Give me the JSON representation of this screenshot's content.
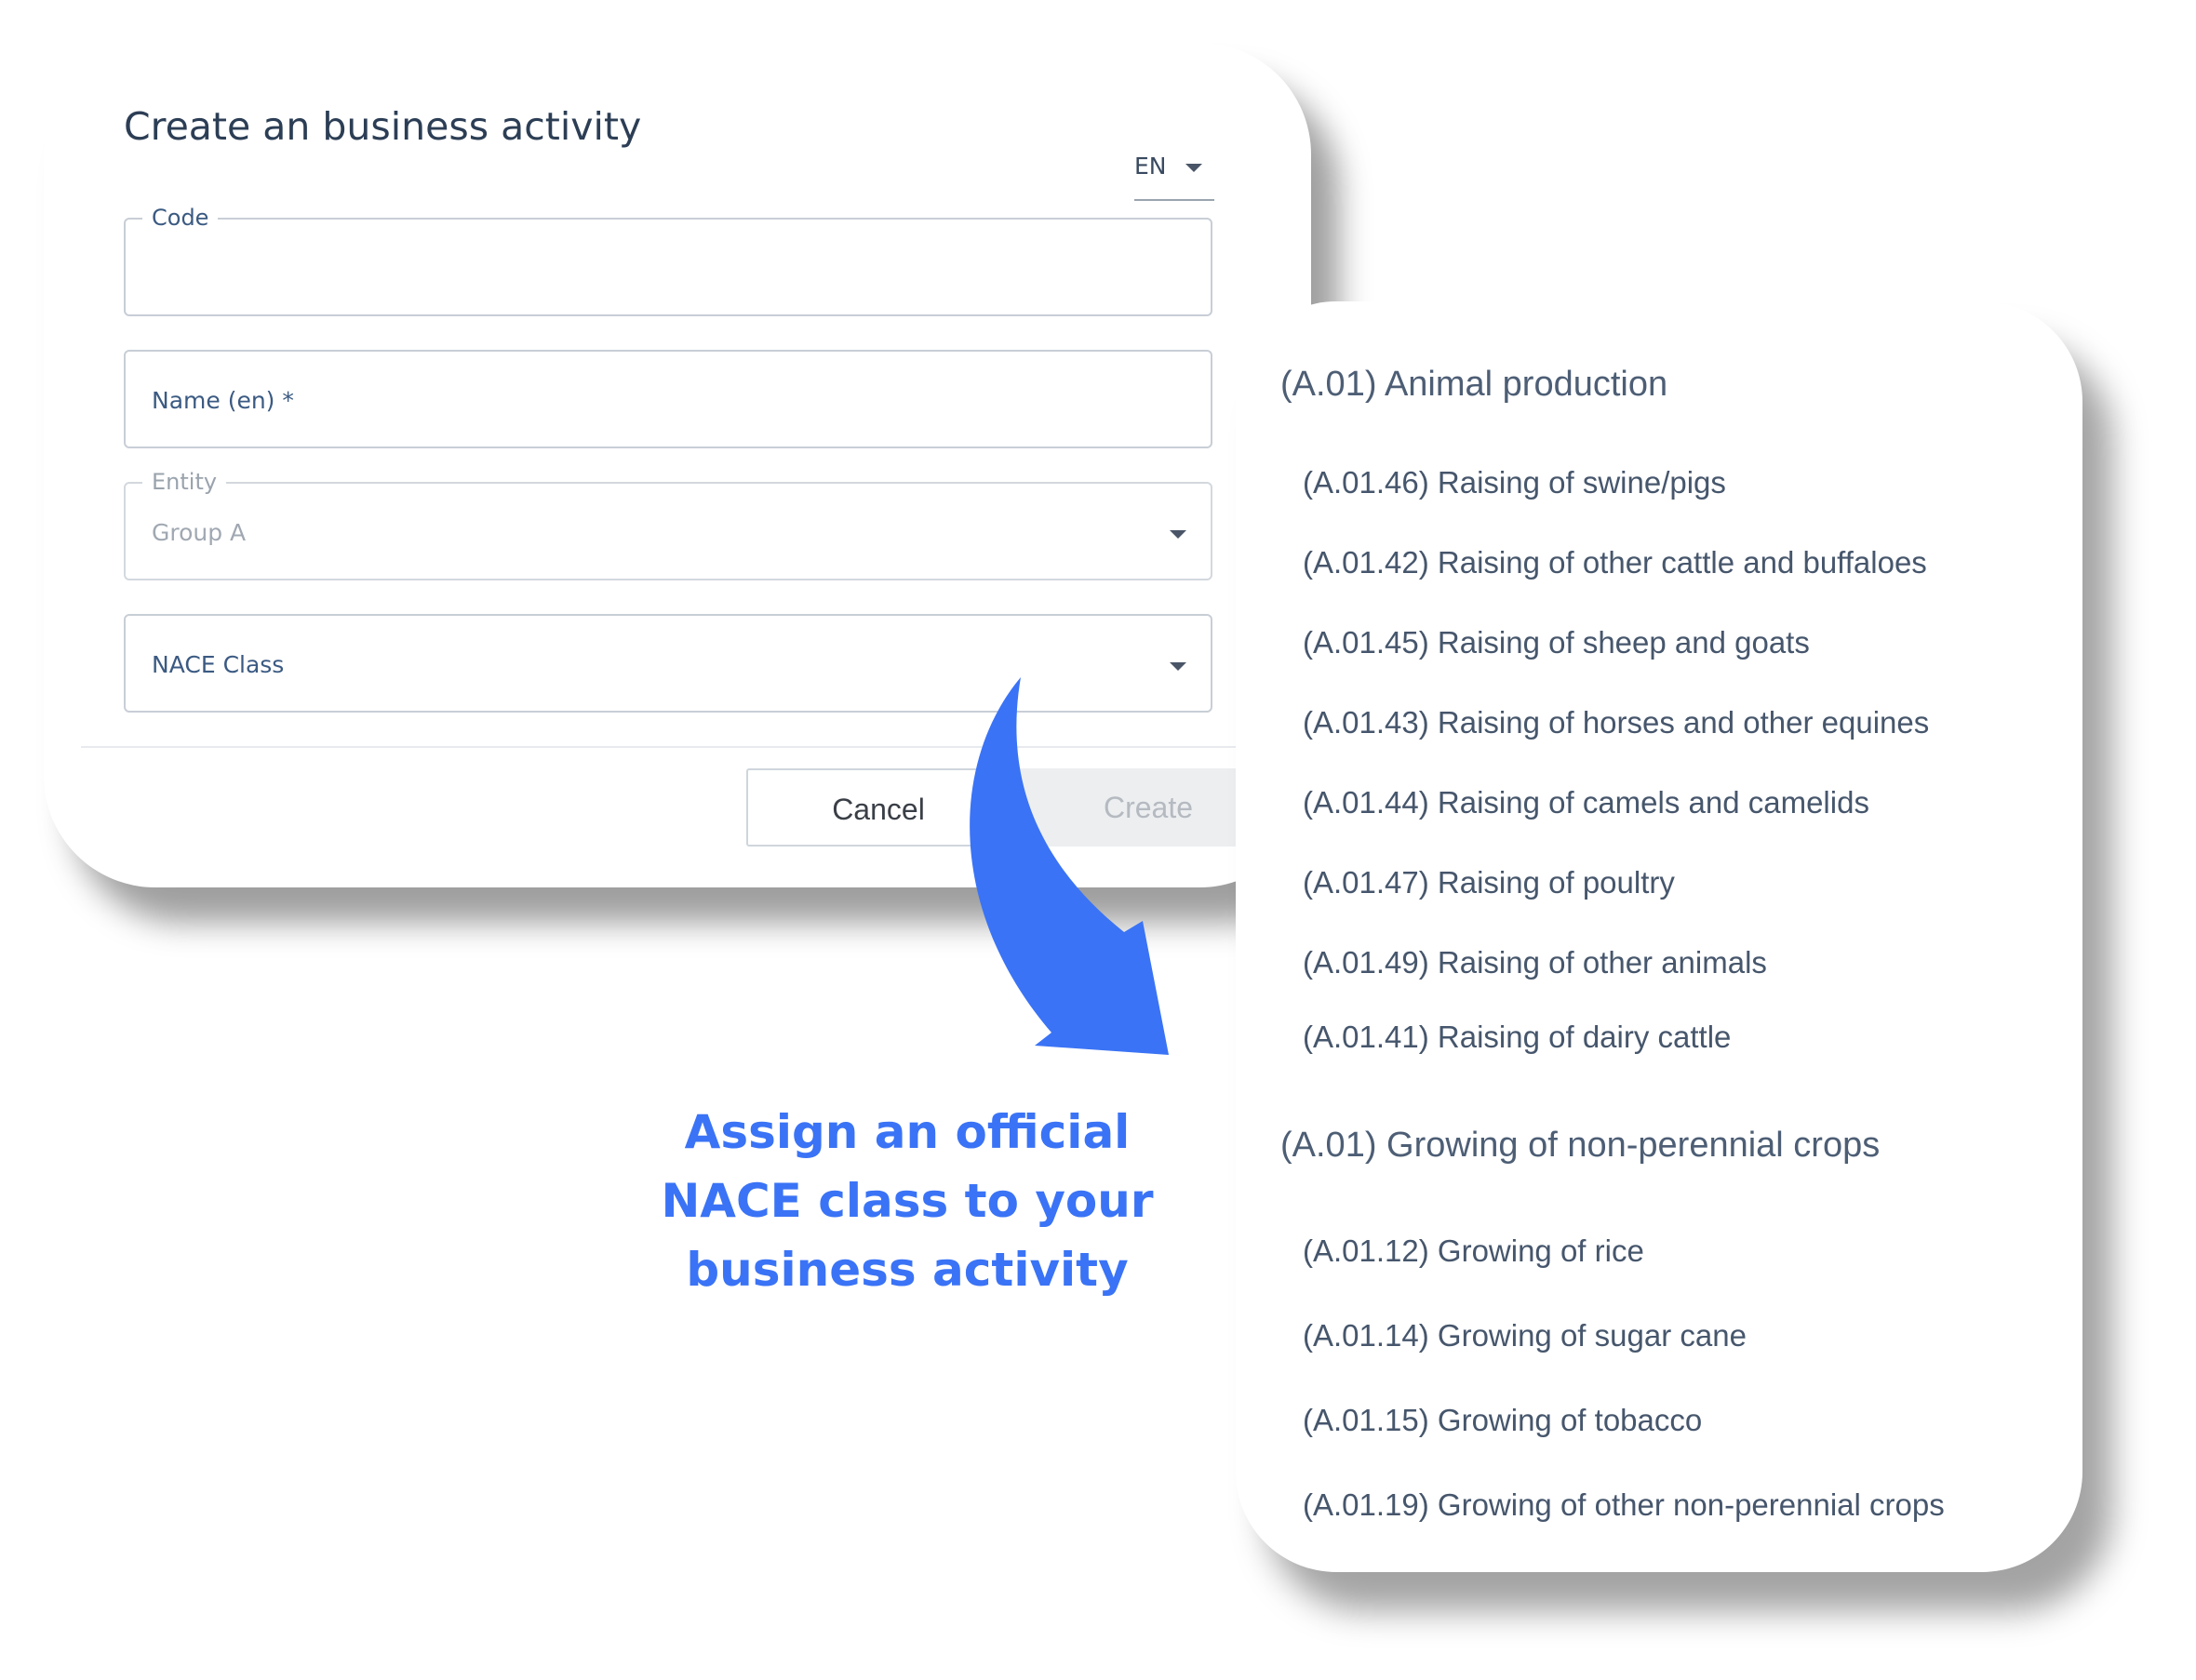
{
  "dialog": {
    "title": "Create an business activity",
    "language": "EN",
    "fields": {
      "code": {
        "label": "Code",
        "value": ""
      },
      "name": {
        "placeholder": "Name (en)  *"
      },
      "entity": {
        "label": "Entity",
        "value": "Group A"
      },
      "nace": {
        "placeholder": "NACE Class"
      }
    },
    "buttons": {
      "cancel": "Cancel",
      "create": "Create"
    }
  },
  "nace_list": {
    "groups": [
      {
        "header": "(A.01) Animal production",
        "items": [
          "(A.01.46) Raising of swine/pigs",
          "(A.01.42) Raising of other cattle and buffaloes",
          "(A.01.45) Raising of sheep and goats",
          "(A.01.43) Raising of horses and other equines",
          "(A.01.44) Raising of camels and camelids",
          "(A.01.47) Raising of poultry",
          "(A.01.49) Raising of other animals",
          "(A.01.41) Raising of dairy cattle"
        ]
      },
      {
        "header": "(A.01) Growing of non-perennial crops",
        "items": [
          "(A.01.12) Growing of rice",
          "(A.01.14) Growing of sugar cane",
          "(A.01.15) Growing of tobacco",
          "(A.01.19) Growing of other non-perennial crops"
        ]
      }
    ]
  },
  "caption": {
    "line1": "Assign an official",
    "line2": "NACE class to your",
    "line3": "business activity"
  },
  "colors": {
    "accent": "#3a73f5",
    "label": "#3b5a82",
    "title": "#2c3e55"
  },
  "icons": {
    "language_dropdown": "chevron-down-icon",
    "entity_dropdown": "chevron-down-icon",
    "nace_dropdown": "chevron-down-icon",
    "arrow": "curved-arrow-icon"
  }
}
